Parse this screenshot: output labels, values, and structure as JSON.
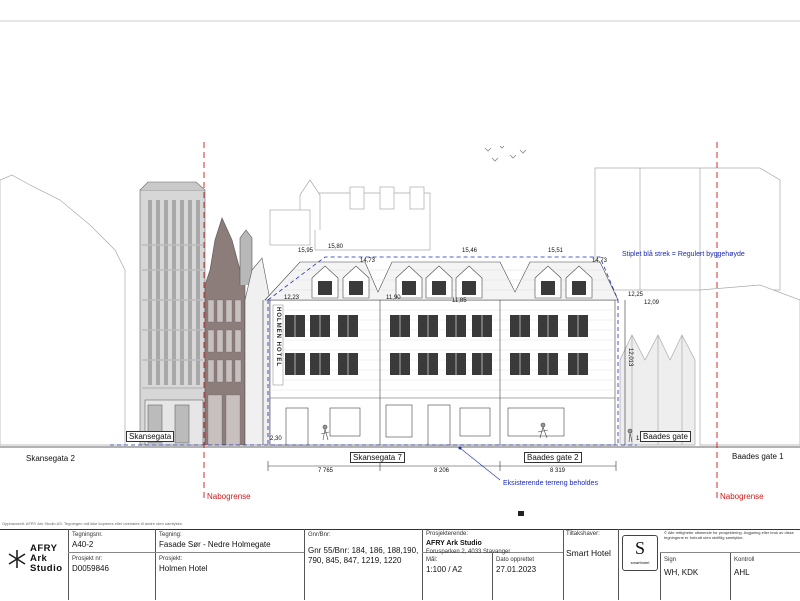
{
  "drawing": {
    "boundary_left": "Nabogrense",
    "boundary_right": "Nabogrense",
    "street_left_edge": "Skansegata 2",
    "street_left_box": "Skansegata",
    "street_right_edge": "Baades gate 1",
    "street_right_box": "Baades gate",
    "label_skansegata7": "Skansegata 7",
    "label_baadesgate2": "Baades gate 2",
    "terrain_note": "Eksisterende terreng beholdes",
    "height_note": "Stiplet blå strek = Regulert byggehøyde",
    "hotel_sign": "HOLMEN HOTEL",
    "dims": {
      "bottom_1": "7 765",
      "bottom_2": "8 206",
      "bottom_3": "8 319",
      "left_base": "2,30",
      "left_eave": "12,23",
      "left_top": "15,95",
      "left_top2": "15,80",
      "mid_top": "15,46",
      "mid_eave": "11,85",
      "right_top": "15,51",
      "right_top2": "14,73",
      "right_eave": "12,25",
      "right_eave2": "12,09",
      "right_height": "12,013",
      "right_base": "1,30",
      "left_mid": "14,73",
      "small_mid": "11,90"
    }
  },
  "title_block": {
    "fine_print": "Opphavsrett: AFRY Ark Studio AS. Tegningen må ikke kopieres eller overlates til andre uten samtykke.",
    "firm_logo": "AFRY Ark Studio",
    "drawing_no_label": "Tegningsnr.",
    "drawing_no": "A40-2",
    "drawing_label": "Tegning:",
    "drawing_title": "Fasade Sør - Nedre Holmegate",
    "gnr_label": "Gnr/Bnr:",
    "gnr_value": "Gnr 55/Bnr: 184, 186, 188,190, 790, 845, 847, 1219, 1220",
    "designer_label": "Prosjekterende:",
    "designer_name": "AFRY Ark Studio",
    "designer_address": "Forusparken 2, 4033 Stavanger",
    "project_no_label": "Prosjekt nr:",
    "project_no": "D0059846",
    "project_label": "Prosjekt:",
    "project_name": "Holmen Hotel",
    "scale_label": "Mål:",
    "scale": "1:100 / A2",
    "date_label": "Dato opprettet",
    "date": "27.01.2023",
    "client_label": "Tiltakshaver:",
    "client": "Smart Hotel",
    "client_logo_letter": "S",
    "client_logo_text": "smarthotel",
    "rights_note": "© Alle rettigheter utførende for prosjektering. Avgjøring eller bruk av disse tegningene er forbudt uten skriftlig samtykke.",
    "sign_label": "Sign",
    "sign": "WH, KDK",
    "control_label": "Kontroll",
    "control": "AHL"
  }
}
